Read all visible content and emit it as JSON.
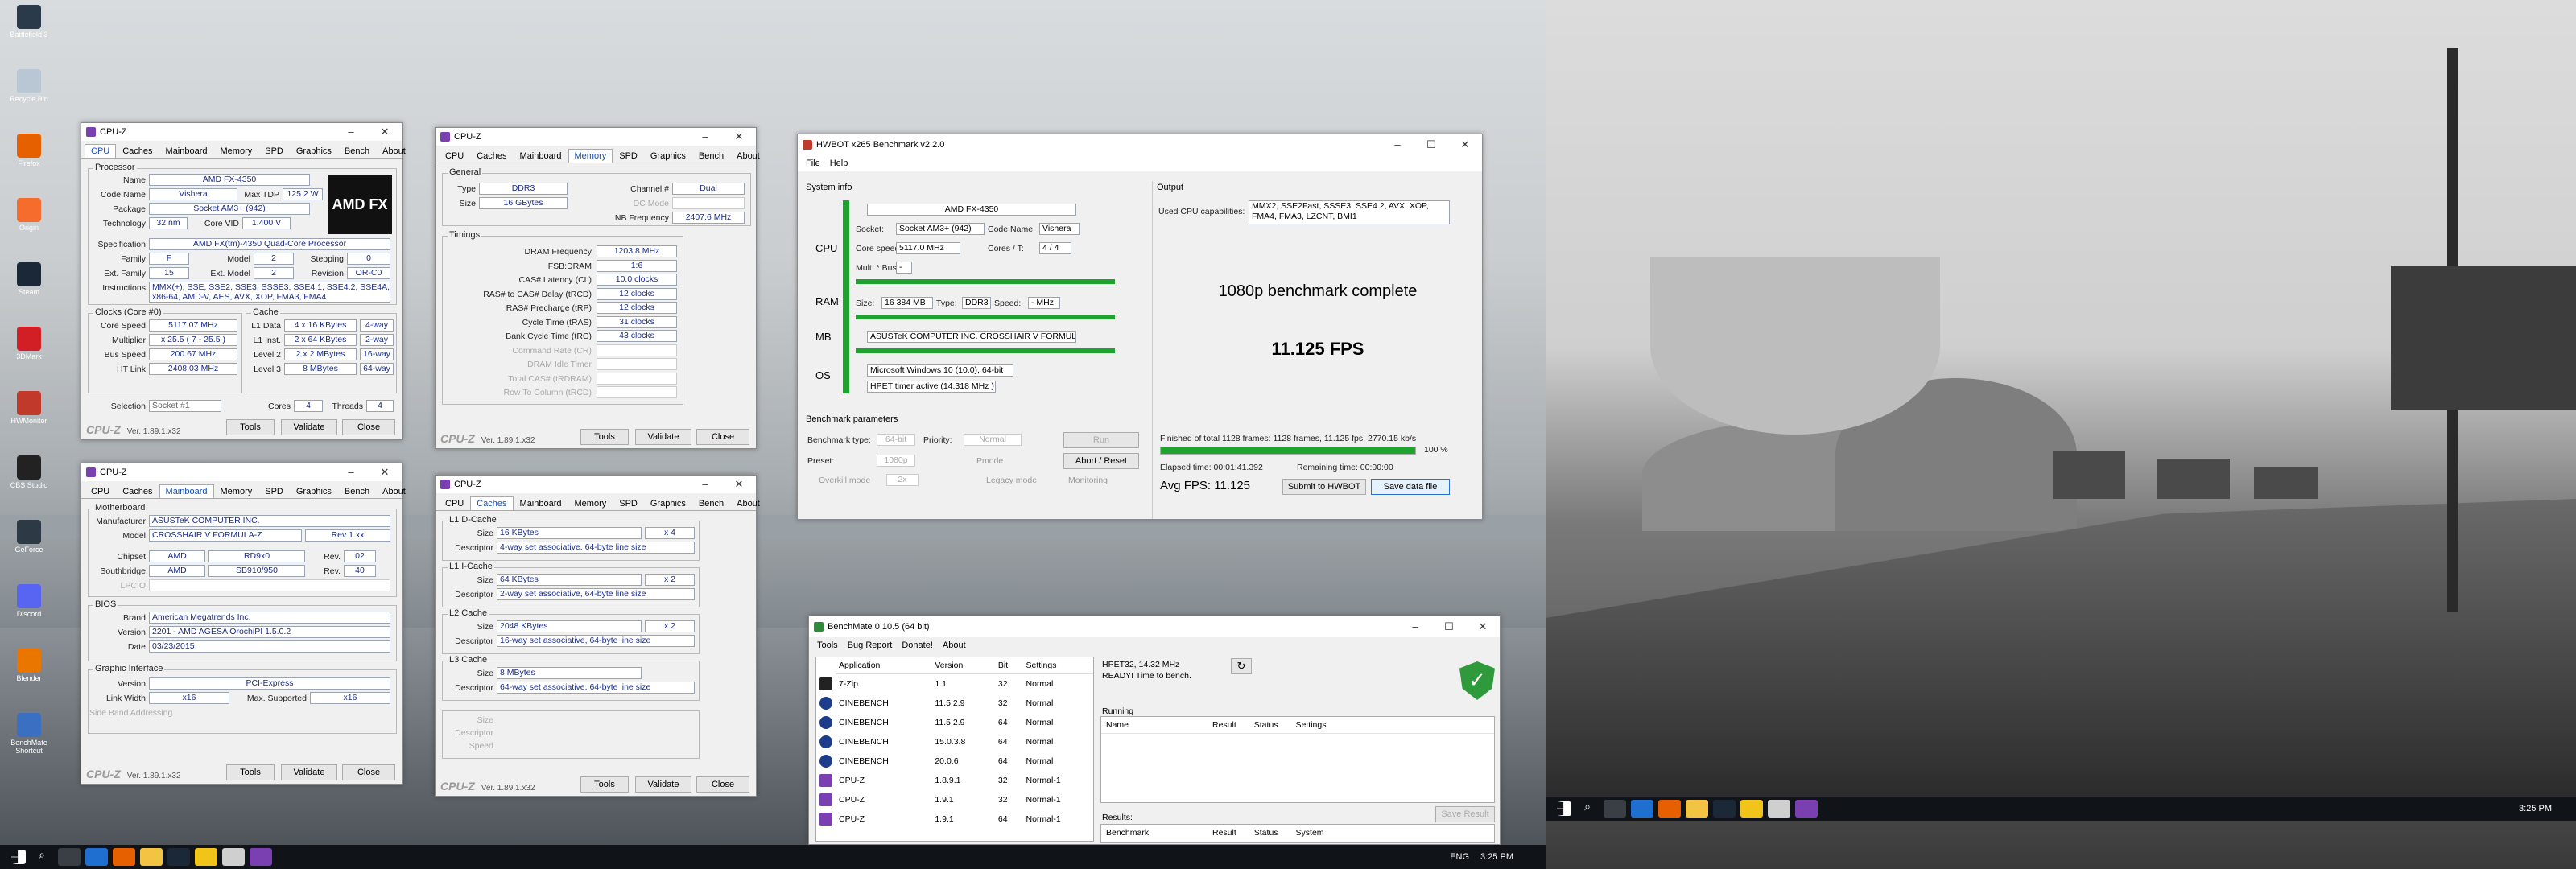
{
  "desktop_icons": [
    {
      "label": "Battlefield 3",
      "color": "#2b3a4a"
    },
    {
      "label": "Recycle Bin",
      "color": "#b9c6d3"
    },
    {
      "label": "Firefox",
      "color": "#e66000"
    },
    {
      "label": "Origin",
      "color": "#f56c2d"
    },
    {
      "label": "Steam",
      "color": "#1b2838"
    },
    {
      "label": "3DMark",
      "color": "#d21f26"
    },
    {
      "label": "HWMonitor",
      "color": "#c0392b"
    },
    {
      "label": "CBS Studio",
      "color": "#222"
    },
    {
      "label": "GeForce",
      "color": "#2d3a45"
    },
    {
      "label": "Discord",
      "color": "#5865f2"
    },
    {
      "label": "Blender",
      "color": "#ea7600"
    },
    {
      "label": "BenchMate Shortcut",
      "color": "#3b6fc2"
    }
  ],
  "cpuz_cpu": {
    "title": "CPU-Z",
    "tabs": [
      "CPU",
      "Caches",
      "Mainboard",
      "Memory",
      "SPD",
      "Graphics",
      "Bench",
      "About"
    ],
    "processor": "Processor",
    "name_l": "Name",
    "name": "AMD FX-4350",
    "codename_l": "Code Name",
    "codename": "Vishera",
    "maxtdp_l": "Max TDP",
    "maxtdp": "125.2 W",
    "package_l": "Package",
    "package": "Socket AM3+ (942)",
    "tech_l": "Technology",
    "tech": "32 nm",
    "vid_l": "Core VID",
    "vid": "1.400 V",
    "spec_l": "Specification",
    "spec": "AMD FX(tm)-4350 Quad-Core Processor",
    "family_l": "Family",
    "family": "F",
    "model_l": "Model",
    "model": "2",
    "stepping_l": "Stepping",
    "stepping": "0",
    "extfam_l": "Ext. Family",
    "extfam": "15",
    "extmodel_l": "Ext. Model",
    "extmodel": "2",
    "rev_l": "Revision",
    "rev": "OR-C0",
    "instr_l": "Instructions",
    "instr": "MMX(+), SSE, SSE2, SSE3, SSSE3, SSE4.1, SSE4.2, SSE4A, x86-64, AMD-V, AES, AVX, XOP, FMA3, FMA4",
    "clocks": "Clocks (Core #0)",
    "cache": "Cache",
    "corespeed_l": "Core Speed",
    "corespeed": "5117.07 MHz",
    "mult_l": "Multiplier",
    "mult": "x 25.5 ( 7 - 25.5 )",
    "bus_l": "Bus Speed",
    "bus": "200.67 MHz",
    "ht_l": "HT Link",
    "ht": "2408.03 MHz",
    "l1d_l": "L1 Data",
    "l1d": "4 x 16 KBytes",
    "l1d_w": "4-way",
    "l1i_l": "L1 Inst.",
    "l1i": "2 x 64 KBytes",
    "l1i_w": "2-way",
    "l2_l": "Level 2",
    "l2": "2 x 2 MBytes",
    "l2_w": "16-way",
    "l3_l": "Level 3",
    "l3": "8 MBytes",
    "l3_w": "64-way",
    "sel_l": "Selection",
    "sel": "Socket #1",
    "cores_l": "Cores",
    "cores": "4",
    "threads_l": "Threads",
    "threads": "4",
    "logo": "CPU-Z",
    "ver": "Ver. 1.89.1.x32",
    "tools": "Tools",
    "validate": "Validate",
    "close": "Close",
    "amd_logo": "AMD FX"
  },
  "cpuz_mem": {
    "title": "CPU-Z",
    "tabs": [
      "CPU",
      "Caches",
      "Mainboard",
      "Memory",
      "SPD",
      "Graphics",
      "Bench",
      "About"
    ],
    "general": "General",
    "type_l": "Type",
    "type": "DDR3",
    "chan_l": "Channel #",
    "chan": "Dual",
    "size_l": "Size",
    "size": "16 GBytes",
    "dcmode_l": "DC Mode",
    "nbf_l": "NB Frequency",
    "nbf": "2407.6 MHz",
    "timings": "Timings",
    "rows": [
      {
        "l": "DRAM Frequency",
        "v": "1203.8 MHz"
      },
      {
        "l": "FSB:DRAM",
        "v": "1:6"
      },
      {
        "l": "CAS# Latency (CL)",
        "v": "10.0 clocks"
      },
      {
        "l": "RAS# to CAS# Delay (tRCD)",
        "v": "12 clocks"
      },
      {
        "l": "RAS# Precharge (tRP)",
        "v": "12 clocks"
      },
      {
        "l": "Cycle Time (tRAS)",
        "v": "31 clocks"
      },
      {
        "l": "Bank Cycle Time (tRC)",
        "v": "43 clocks"
      },
      {
        "l": "Command Rate (CR)",
        "v": ""
      },
      {
        "l": "DRAM Idle Timer",
        "v": ""
      },
      {
        "l": "Total CAS# (tRDRAM)",
        "v": ""
      },
      {
        "l": "Row To Column (tRCD)",
        "v": ""
      }
    ],
    "logo": "CPU-Z",
    "ver": "Ver. 1.89.1.x32",
    "tools": "Tools",
    "validate": "Validate",
    "close": "Close"
  },
  "cpuz_mb": {
    "title": "CPU-Z",
    "tabs": [
      "CPU",
      "Caches",
      "Mainboard",
      "Memory",
      "SPD",
      "Graphics",
      "Bench",
      "About"
    ],
    "motherboard": "Motherboard",
    "manu_l": "Manufacturer",
    "manu": "ASUSTeK COMPUTER INC.",
    "model_l": "Model",
    "model": "CROSSHAIR V FORMULA-Z",
    "model_rev": "Rev 1.xx",
    "chipset_l": "Chipset",
    "chipset": "AMD",
    "chipset2": "RD9x0",
    "chipset_rev_l": "Rev.",
    "chipset_rev": "02",
    "sb_l": "Southbridge",
    "sb": "AMD",
    "sb2": "SB910/950",
    "sb_rev_l": "Rev.",
    "sb_rev": "40",
    "lpcio_l": "LPCIO",
    "bios": "BIOS",
    "brand_l": "Brand",
    "brand": "American Megatrends Inc.",
    "bver_l": "Version",
    "bver": "2201 - AMD AGESA OrochiPI 1.5.0.2",
    "date_l": "Date",
    "date": "03/23/2015",
    "gi": "Graphic Interface",
    "giver_l": "Version",
    "giver": "PCI-Express",
    "lw_l": "Link Width",
    "lw": "x16",
    "ms_l": "Max. Supported",
    "ms": "x16",
    "sba_l": "Side Band Addressing",
    "logo": "CPU-Z",
    "ver": "Ver. 1.89.1.x32",
    "tools": "Tools",
    "validate": "Validate",
    "close": "Close"
  },
  "cpuz_cache": {
    "title": "CPU-Z",
    "tabs": [
      "CPU",
      "Caches",
      "Mainboard",
      "Memory",
      "SPD",
      "Graphics",
      "Bench",
      "About"
    ],
    "groups": [
      {
        "name": "L1 D-Cache",
        "size": "16 KBytes",
        "mult": "x 4",
        "desc": "4-way set associative, 64-byte line size"
      },
      {
        "name": "L1 I-Cache",
        "size": "64 KBytes",
        "mult": "x 2",
        "desc": "2-way set associative, 64-byte line size"
      },
      {
        "name": "L2 Cache",
        "size": "2048 KBytes",
        "mult": "x 2",
        "desc": "16-way set associative, 64-byte line size"
      },
      {
        "name": "L3 Cache",
        "size": "8 MBytes",
        "mult": "",
        "desc": "64-way set associative, 64-byte line size"
      }
    ],
    "size_l": "Size",
    "desc_l": "Descriptor",
    "speed_l": "Speed",
    "logo": "CPU-Z",
    "ver": "Ver. 1.89.1.x32",
    "tools": "Tools",
    "validate": "Validate",
    "close": "Close"
  },
  "hwbot": {
    "title": "HWBOT x265 Benchmark v2.2.0",
    "menu": [
      "File",
      "Help"
    ],
    "sysinfo": "System info",
    "output": "Output",
    "cpu_l": "CPU",
    "ram_l": "RAM",
    "mb_l": "MB",
    "os_l": "OS",
    "cpu": "AMD FX-4350",
    "socket_l": "Socket:",
    "socket": "Socket AM3+ (942)",
    "codename_l": "Code Name:",
    "codename": "Vishera",
    "corespeed_l": "Core speed:",
    "corespeed": "5117.0 MHz",
    "coresT_l": "Cores / T:",
    "coresT": "4 / 4",
    "mult_l": "Mult. * Bus:",
    "mult": "-",
    "size_l": "Size:",
    "size": "16 384 MB",
    "type_l": "Type:",
    "type": "DDR3",
    "speed_l": "Speed:",
    "speed": "- MHz",
    "mb": "ASUSTeK COMPUTER INC. CROSSHAIR V FORMULA-Z",
    "os": "Microsoft Windows 10 (10.0), 64-bit",
    "hpet": "HPET timer active (14.318 MHz )",
    "capab_l": "Used CPU capabilities:",
    "capab": "MMX2, SSE2Fast, SSSE3, SSE4.2, AVX, XOP, FMA4, FMA3, LZCNT, BMI1",
    "complete": "1080p benchmark complete",
    "fps": "11.125 FPS",
    "params": "Benchmark parameters",
    "btype_l": "Benchmark type:",
    "btype": "64-bit",
    "prio_l": "Priority:",
    "prio": "Normal",
    "run": "Run",
    "preset_l": "Preset:",
    "preset": "1080p",
    "pmode": "Pmode",
    "abort": "Abort / Reset",
    "overkill": "Overkill mode",
    "overkill_v": "2x",
    "legacy": "Legacy mode",
    "monitoring": "Monitoring",
    "finished": "Finished of total 1128 frames: 1128 frames, 11.125 fps,  2770.15 kb/s",
    "progress_pct": 100,
    "progress_label": "100 %",
    "elapsed": "Elapsed time: 00:01:41.392",
    "remaining": "Remaining time: 00:00:00",
    "avg": "Avg FPS: 11.125",
    "submit": "Submit to HWBOT",
    "save": "Save data file"
  },
  "benchmate": {
    "title": "BenchMate 0.10.5 (64 bit)",
    "menu": [
      "Tools",
      "Bug Report",
      "Donate!",
      "About"
    ],
    "cols": [
      "Application",
      "Version",
      "Bit",
      "Settings"
    ],
    "rows": [
      {
        "app": "7-Zip",
        "ver": "1.1",
        "bit": "32",
        "set": "Normal",
        "ic": "#222"
      },
      {
        "app": "CINEBENCH",
        "ver": "11.5.2.9",
        "bit": "32",
        "set": "Normal",
        "ic": "#1e3c8c"
      },
      {
        "app": "CINEBENCH",
        "ver": "11.5.2.9",
        "bit": "64",
        "set": "Normal",
        "ic": "#1e3c8c"
      },
      {
        "app": "CINEBENCH",
        "ver": "15.0.3.8",
        "bit": "64",
        "set": "Normal",
        "ic": "#1e3c8c"
      },
      {
        "app": "CINEBENCH",
        "ver": "20.0.6",
        "bit": "64",
        "set": "Normal",
        "ic": "#1e3c8c"
      },
      {
        "app": "CPU-Z",
        "ver": "1.8.9.1",
        "bit": "32",
        "set": "Normal-1",
        "ic": "#7a3fb0"
      },
      {
        "app": "CPU-Z",
        "ver": "1.9.1",
        "bit": "32",
        "set": "Normal-1",
        "ic": "#7a3fb0"
      },
      {
        "app": "CPU-Z",
        "ver": "1.9.1",
        "bit": "64",
        "set": "Normal-1",
        "ic": "#7a3fb0"
      }
    ],
    "hpet": "HPET32, 14.32 MHz",
    "ready": "READY! Time to bench.",
    "running": "Running",
    "run_cols": [
      "Name",
      "Result",
      "Status",
      "Settings"
    ],
    "results": "Results:",
    "save_result": "Save Result",
    "res_cols": [
      "Benchmark",
      "Result",
      "Status",
      "System"
    ]
  },
  "taskbar": {
    "lang": "ENG",
    "time_l": "3:25 PM",
    "time_r": "3:25 PM"
  },
  "colors": {
    "accent_green": "#1fa22f",
    "cpuz_value": "#1a2d8a",
    "cpuz_tab": "#1550b8"
  }
}
